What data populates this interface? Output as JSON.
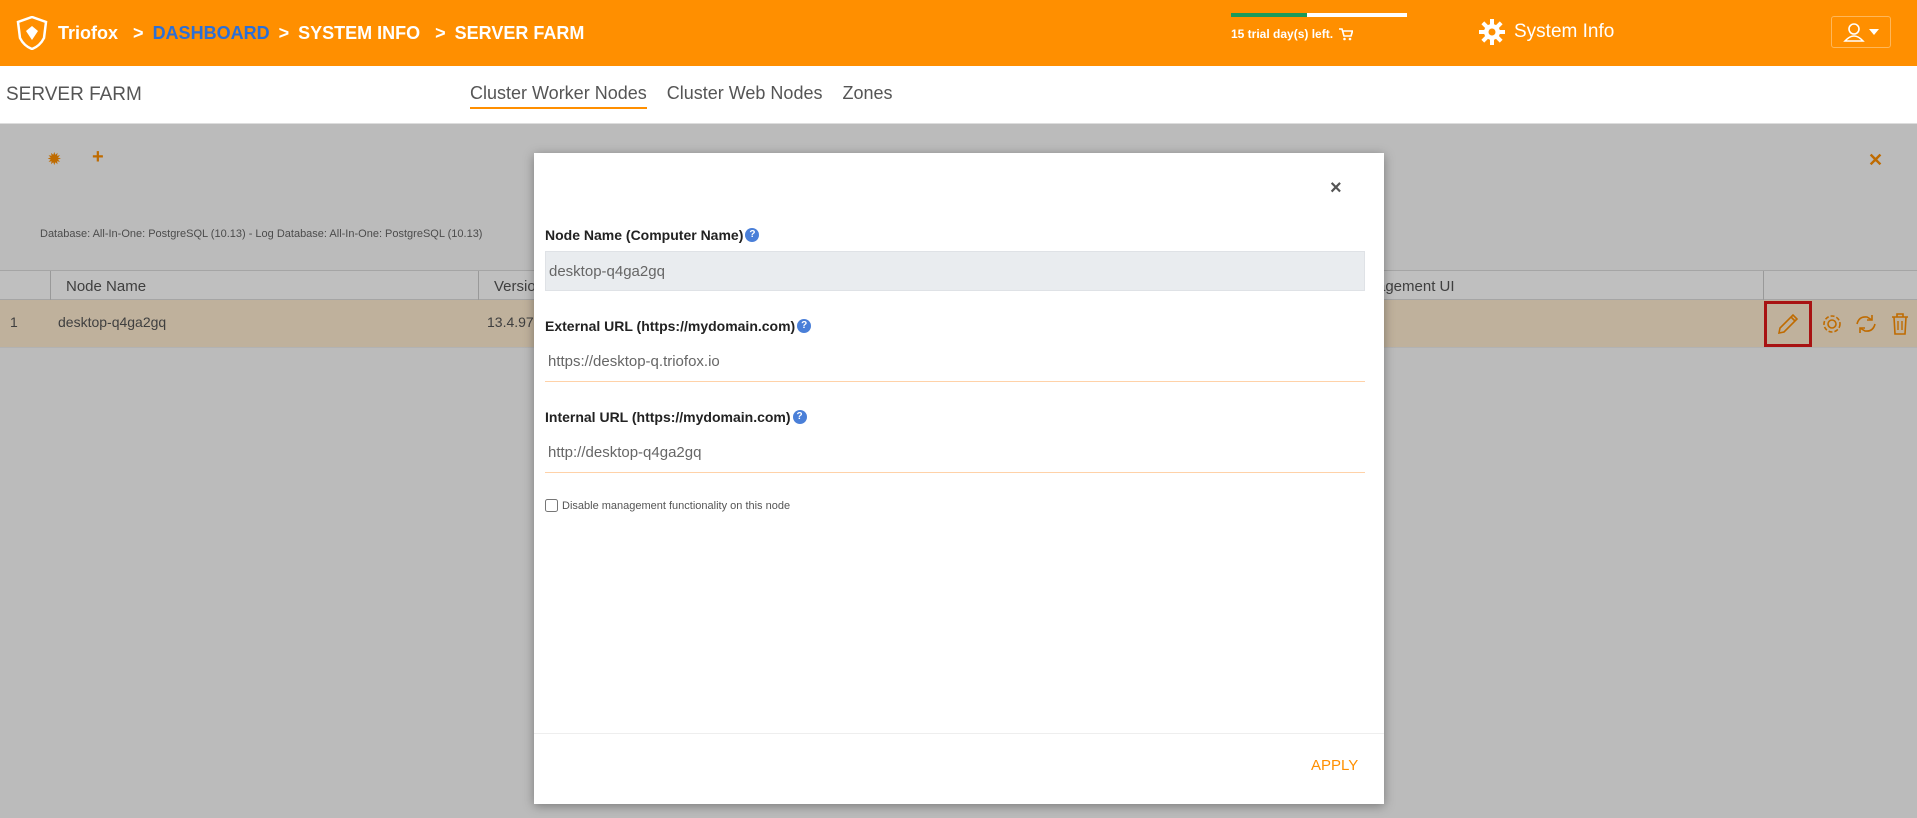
{
  "topbar": {
    "brand": "Triofox",
    "crumbs": [
      "DASHBOARD",
      "SYSTEM INFO",
      "SERVER FARM"
    ],
    "crumb_sep": ">",
    "trial_text": "15 trial day(s) left.",
    "trial_progress": 0.43,
    "system_info_label": "System Info"
  },
  "subheader": {
    "title": "SERVER FARM",
    "tabs": [
      "Cluster Worker Nodes",
      "Cluster Web Nodes",
      "Zones"
    ]
  },
  "content": {
    "db_info": "Database: All-In-One: PostgreSQL (10.13) - Log Database: All-In-One: PostgreSQL (10.13)",
    "columns": [
      "Node Name",
      "Versio",
      "agement UI"
    ],
    "row": {
      "index": "1",
      "node_name": "desktop-q4ga2gq",
      "version": "13.4.97"
    }
  },
  "modal": {
    "close_label": "×",
    "fields": [
      {
        "label": "Node Name (Computer Name)",
        "value": "desktop-q4ga2gq"
      },
      {
        "label": "External URL (https://mydomain.com)",
        "value": "https://desktop-q.triofox.io"
      },
      {
        "label": "Internal URL (https://mydomain.com)",
        "value": "http://desktop-q4ga2gq"
      }
    ],
    "help_glyph": "?",
    "checkbox_label": "Disable management functionality on this node",
    "apply_label": "APPLY"
  },
  "colors": {
    "accent": "#ff8f00",
    "link": "#2c6fd6",
    "highlight": "#e01818"
  }
}
